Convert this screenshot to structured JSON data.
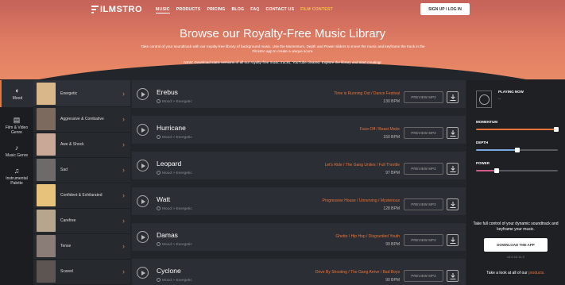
{
  "header": {
    "logo": "ILMSTRO",
    "nav": [
      "MUSIC",
      "PRODUCTS",
      "PRICING",
      "BLOG",
      "FAQ",
      "CONTACT US",
      "FILM CONTEST"
    ],
    "signup": "SIGN UP / LOG IN"
  },
  "hero": {
    "title": "Browse our Royalty-Free Music Library",
    "description": "Take control of your soundtrack with our royalty-free library of background music. Use the Momentum, Depth and Power sliders to move the music and keyframe the track in the Filmstro app to create a unique score.",
    "new": "NEW: Download static versions of all our royalty-free music tracks, YouTube cleared. Explore the library and start creating!"
  },
  "categories": [
    {
      "label": "Mood",
      "icon": "mood-icon"
    },
    {
      "label": "Film & Video Genre",
      "icon": "film-icon"
    },
    {
      "label": "Music Genre",
      "icon": "guitar-icon"
    },
    {
      "label": "Instrumental Palette",
      "icon": "instrument-icon"
    }
  ],
  "moods": [
    {
      "label": "Energetic",
      "color": "#d9b78a"
    },
    {
      "label": "Aggressive & Combative",
      "color": "#7d6a5e"
    },
    {
      "label": "Awe & Shock",
      "color": "#c9a898"
    },
    {
      "label": "Sad",
      "color": "#6e6a6a"
    },
    {
      "label": "Confident & Exhilarated",
      "color": "#e7c27a"
    },
    {
      "label": "Carefree",
      "color": "#b8a58e"
    },
    {
      "label": "Tense",
      "color": "#8a7c76"
    },
    {
      "label": "Scared",
      "color": "#5d5552"
    }
  ],
  "tracks": [
    {
      "name": "Erebus",
      "meta": "Mood > Energetic",
      "tags": "Time is Running Out  /  Dance Festival",
      "bpm": "130 BPM",
      "preview": "PREVIEW MP3"
    },
    {
      "name": "Hurricane",
      "meta": "Mood > Energetic",
      "tags": "Face-Off  /  Beast Mode",
      "bpm": "150 BPM",
      "preview": "PREVIEW MP3"
    },
    {
      "name": "Leopard",
      "meta": "Mood > Energetic",
      "tags": "Let's Ride  /  The Gang Unites  /  Full Throttle",
      "bpm": "97 BPM",
      "preview": "PREVIEW MP3"
    },
    {
      "name": "Watt",
      "meta": "Mood > Energetic",
      "tags": "Progressive House  /  Unnerving  /  Mysterious",
      "bpm": "128 BPM",
      "preview": "PREVIEW MP3"
    },
    {
      "name": "Damas",
      "meta": "Mood > Energetic",
      "tags": "Ghetto  /  Hip Hop  /  Disgruntled Youth",
      "bpm": "99 BPM",
      "preview": "PREVIEW MP3"
    },
    {
      "name": "Cyclone",
      "meta": "Mood > Energetic",
      "tags": "Drive By Shooting  /  The Gang Arrive  /  Bad Boys",
      "bpm": "90 BPM",
      "preview": "PREVIEW MP3"
    }
  ],
  "player": {
    "now_playing": "PLAYING NOW",
    "dash": "--",
    "sliders": [
      {
        "label": "MOMENTUM",
        "value": 0.98,
        "color": "#e8743b"
      },
      {
        "label": "DEPTH",
        "value": 0.5,
        "color": "#7aa7e0"
      },
      {
        "label": "POWER",
        "value": 0.25,
        "color": "#d35b8c"
      }
    ],
    "promo": "Take full control of your dynamic soundtrack and keyframe your music.",
    "download": "DOWNLOAD THE APP",
    "version": "v3.0.10.11.0",
    "look": "Take a look at all of our",
    "look_link": "products."
  }
}
